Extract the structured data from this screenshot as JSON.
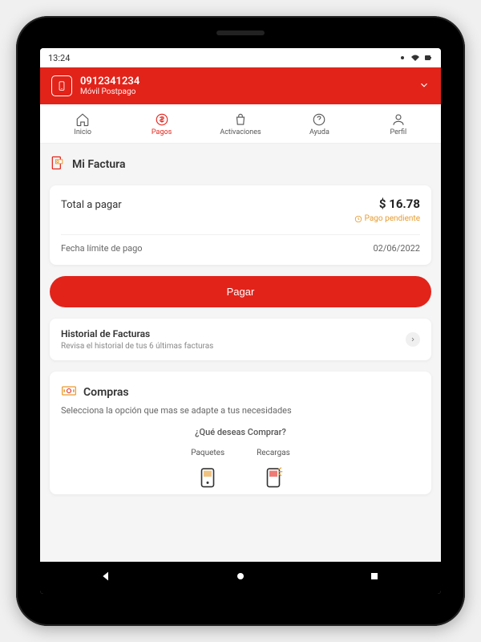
{
  "status": {
    "time": "13:24"
  },
  "header": {
    "phone": "0912341234",
    "plan": "Móvil Postpago"
  },
  "tabs": [
    {
      "label": "Inicio"
    },
    {
      "label": "Pagos"
    },
    {
      "label": "Activaciones"
    },
    {
      "label": "Ayuda"
    },
    {
      "label": "Perfil"
    }
  ],
  "invoice": {
    "section_title": "Mi Factura",
    "total_label": "Total a pagar",
    "total_amount": "$ 16.78",
    "pending_label": "Pago pendiente",
    "due_label": "Fecha límite de pago",
    "due_date": "02/06/2022",
    "pay_button": "Pagar"
  },
  "history": {
    "title": "Historial de Facturas",
    "subtitle": "Revisa el historial de tus 6 últimas facturas"
  },
  "compras": {
    "section_title": "Compras",
    "subtitle": "Selecciona la opción que mas se adapte a tus necesidades",
    "question": "¿Qué deseas Comprar?",
    "option_paquetes": "Paquetes",
    "option_recargas": "Recargas"
  }
}
